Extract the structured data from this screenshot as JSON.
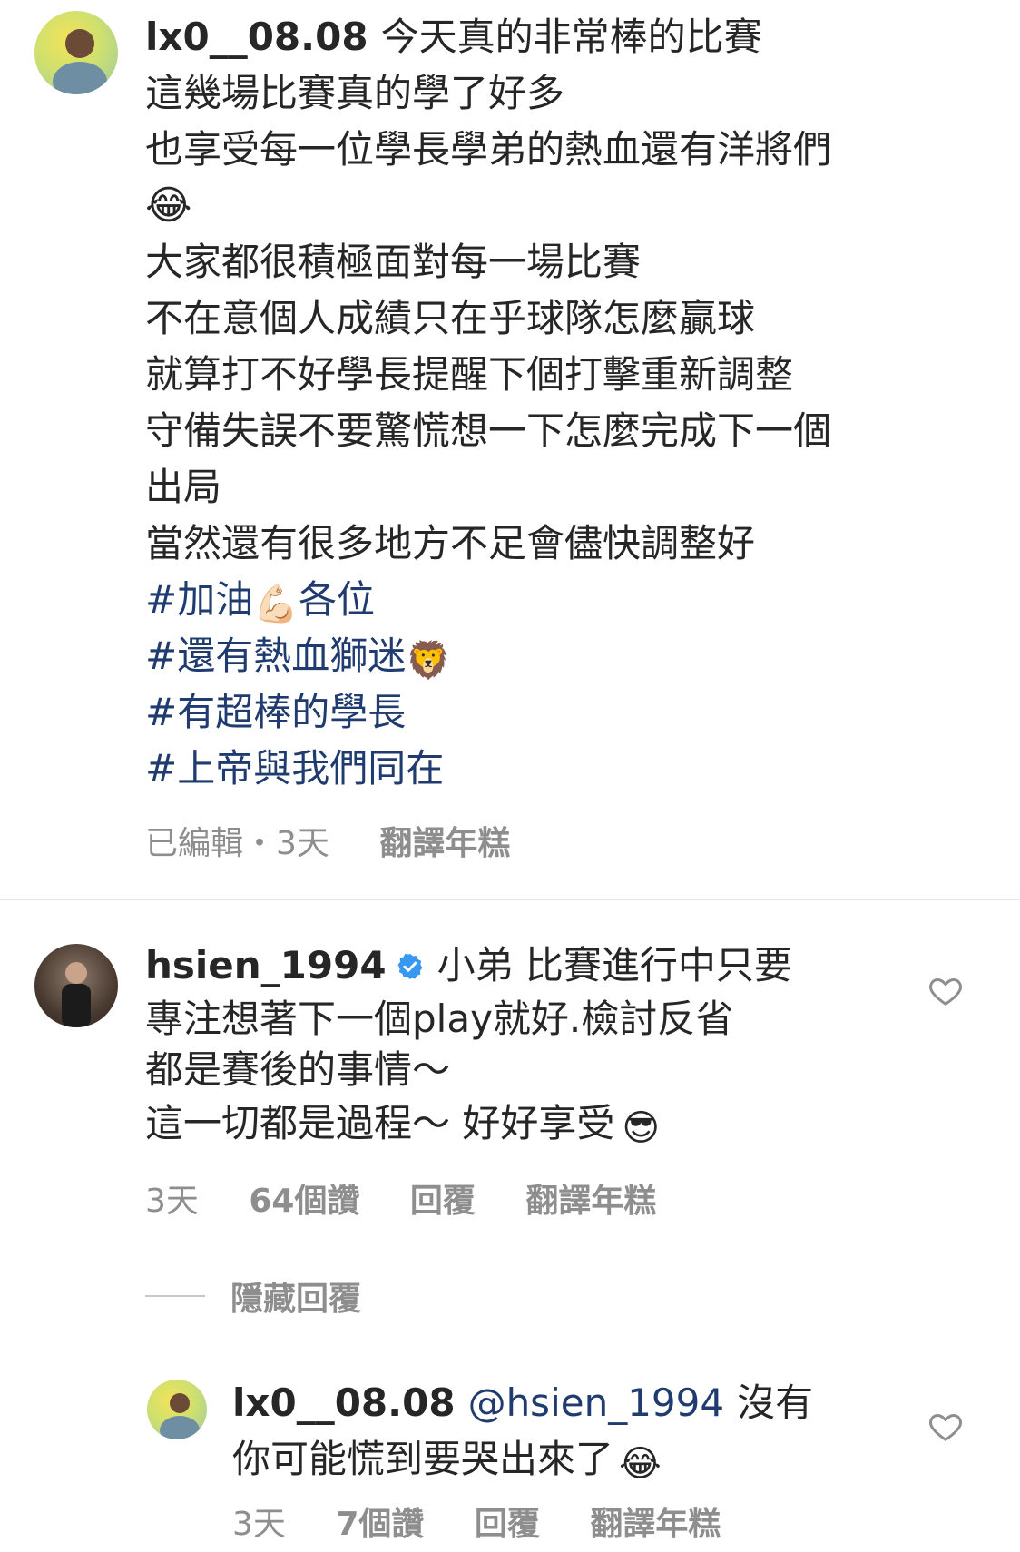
{
  "comment1": {
    "username": "lx0__08.08",
    "lines": [
      "今天真的非常棒的比賽",
      "這幾場比賽真的學了好多",
      "也享受每一位學長學弟的熱血還有洋將們",
      "😂",
      "大家都很積極面對每一場比賽",
      "不在意個人成績只在乎球隊怎麼贏球",
      "就算打不好學長提醒下個打擊重新調整",
      "守備失誤不要驚慌想一下怎麼完成下一個",
      "出局",
      "當然還有很多地方不足會儘快調整好"
    ],
    "hashtags": [
      {
        "text": "#加油",
        "emoji": "💪🏻",
        "after": "各位"
      },
      {
        "text": "#還有熱血獅迷",
        "emoji": "🦁",
        "after": ""
      },
      {
        "text": "#有超棒的學長",
        "emoji": "",
        "after": ""
      },
      {
        "text": "#上帝與我們同在",
        "emoji": "",
        "after": ""
      }
    ],
    "meta": {
      "edited": "已編輯・3天",
      "translate": "翻譯年糕"
    }
  },
  "comment2": {
    "username": "hsien_1994",
    "first_line": "小弟 比賽進行中只要",
    "lines": [
      "專注想著下一個play就好.檢討反省",
      "都是賽後的事情～",
      "這一切都是過程～ 好好享受"
    ],
    "last_emoji": "😎",
    "meta": {
      "time": "3天",
      "likes": "64個讚",
      "reply": "回覆",
      "translate": "翻譯年糕"
    },
    "hide_replies": "隱藏回覆"
  },
  "reply1": {
    "username": "lx0__08.08",
    "mention": "@hsien_1994",
    "first_line": "沒有",
    "line2": "你可能慌到要哭出來了",
    "emoji": "😂",
    "meta": {
      "time": "3天",
      "likes": "7個讚",
      "reply": "回覆",
      "translate": "翻譯年糕"
    }
  },
  "colors": {
    "hashtag": "#1f3b6f",
    "meta": "#8e8e8e",
    "verified": "#3897f0"
  },
  "icons": [
    "heart-icon",
    "verified-badge-icon"
  ]
}
